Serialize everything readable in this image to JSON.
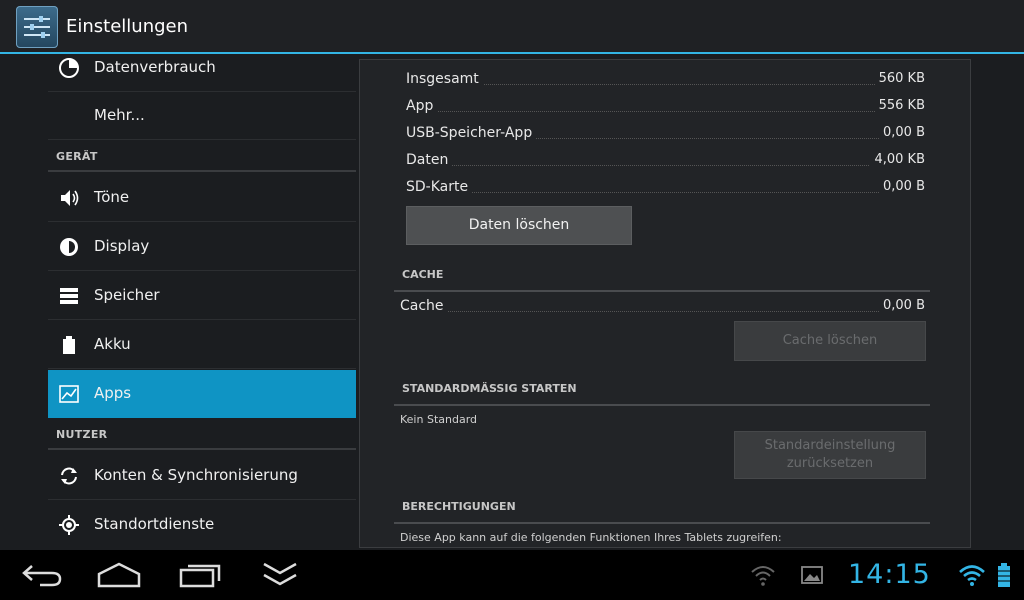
{
  "actionbar": {
    "title": "Einstellungen"
  },
  "sidebar": {
    "items_top": [
      {
        "label": "Datenverbrauch",
        "icon": "data-usage-icon"
      },
      {
        "label": "Mehr..."
      }
    ],
    "section_device": "GERÄT",
    "device_items": [
      {
        "label": "Töne",
        "icon": "volume-icon"
      },
      {
        "label": "Display",
        "icon": "brightness-icon"
      },
      {
        "label": "Speicher",
        "icon": "storage-icon"
      },
      {
        "label": "Akku",
        "icon": "battery-icon"
      },
      {
        "label": "Apps",
        "icon": "apps-icon",
        "active": true
      }
    ],
    "section_user": "NUTZER",
    "user_items": [
      {
        "label": "Konten & Synchronisierung",
        "icon": "sync-icon"
      },
      {
        "label": "Standortdienste",
        "icon": "location-icon"
      }
    ]
  },
  "storage": {
    "rows": [
      {
        "label": "Insgesamt",
        "value": "560 KB"
      },
      {
        "label": "App",
        "value": "556 KB"
      },
      {
        "label": "USB-Speicher-App",
        "value": "0,00 B"
      },
      {
        "label": "Daten",
        "value": "4,00 KB"
      },
      {
        "label": "SD-Karte",
        "value": "0,00 B"
      }
    ],
    "clear_data_button": "Daten löschen"
  },
  "cache": {
    "header": "CACHE",
    "label": "Cache",
    "value": "0,00 B",
    "clear_button": "Cache löschen"
  },
  "launch_default": {
    "header": "STANDARDMÄSSIG STARTEN",
    "text": "Kein Standard",
    "reset_button_line1": "Standardeinstellung",
    "reset_button_line2": "zurücksetzen"
  },
  "permissions": {
    "header": "BERECHTIGUNGEN",
    "text": "Diese App kann auf die folgenden Funktionen Ihres Tablets zugreifen:"
  },
  "systembar": {
    "clock": "14:15",
    "accent": "#33b5e5"
  }
}
